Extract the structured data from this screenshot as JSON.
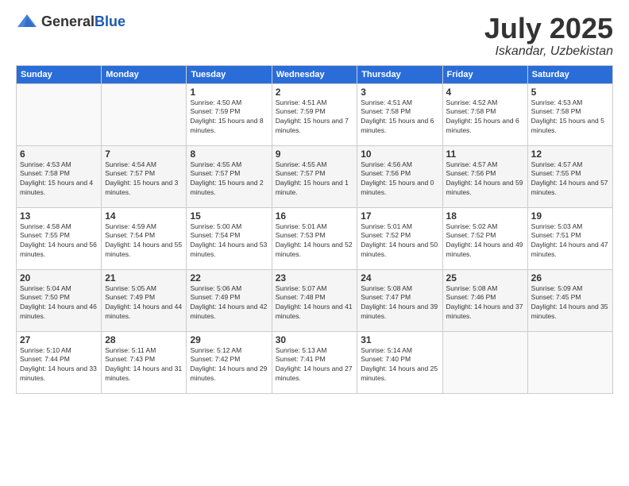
{
  "header": {
    "logo_general": "General",
    "logo_blue": "Blue",
    "month": "July 2025",
    "location": "Iskandar, Uzbekistan"
  },
  "days_of_week": [
    "Sunday",
    "Monday",
    "Tuesday",
    "Wednesday",
    "Thursday",
    "Friday",
    "Saturday"
  ],
  "weeks": [
    [
      {
        "day": "",
        "sunrise": "",
        "sunset": "",
        "daylight": ""
      },
      {
        "day": "",
        "sunrise": "",
        "sunset": "",
        "daylight": ""
      },
      {
        "day": "1",
        "sunrise": "Sunrise: 4:50 AM",
        "sunset": "Sunset: 7:59 PM",
        "daylight": "Daylight: 15 hours and 8 minutes."
      },
      {
        "day": "2",
        "sunrise": "Sunrise: 4:51 AM",
        "sunset": "Sunset: 7:59 PM",
        "daylight": "Daylight: 15 hours and 7 minutes."
      },
      {
        "day": "3",
        "sunrise": "Sunrise: 4:51 AM",
        "sunset": "Sunset: 7:58 PM",
        "daylight": "Daylight: 15 hours and 6 minutes."
      },
      {
        "day": "4",
        "sunrise": "Sunrise: 4:52 AM",
        "sunset": "Sunset: 7:58 PM",
        "daylight": "Daylight: 15 hours and 6 minutes."
      },
      {
        "day": "5",
        "sunrise": "Sunrise: 4:53 AM",
        "sunset": "Sunset: 7:58 PM",
        "daylight": "Daylight: 15 hours and 5 minutes."
      }
    ],
    [
      {
        "day": "6",
        "sunrise": "Sunrise: 4:53 AM",
        "sunset": "Sunset: 7:58 PM",
        "daylight": "Daylight: 15 hours and 4 minutes."
      },
      {
        "day": "7",
        "sunrise": "Sunrise: 4:54 AM",
        "sunset": "Sunset: 7:57 PM",
        "daylight": "Daylight: 15 hours and 3 minutes."
      },
      {
        "day": "8",
        "sunrise": "Sunrise: 4:55 AM",
        "sunset": "Sunset: 7:57 PM",
        "daylight": "Daylight: 15 hours and 2 minutes."
      },
      {
        "day": "9",
        "sunrise": "Sunrise: 4:55 AM",
        "sunset": "Sunset: 7:57 PM",
        "daylight": "Daylight: 15 hours and 1 minute."
      },
      {
        "day": "10",
        "sunrise": "Sunrise: 4:56 AM",
        "sunset": "Sunset: 7:56 PM",
        "daylight": "Daylight: 15 hours and 0 minutes."
      },
      {
        "day": "11",
        "sunrise": "Sunrise: 4:57 AM",
        "sunset": "Sunset: 7:56 PM",
        "daylight": "Daylight: 14 hours and 59 minutes."
      },
      {
        "day": "12",
        "sunrise": "Sunrise: 4:57 AM",
        "sunset": "Sunset: 7:55 PM",
        "daylight": "Daylight: 14 hours and 57 minutes."
      }
    ],
    [
      {
        "day": "13",
        "sunrise": "Sunrise: 4:58 AM",
        "sunset": "Sunset: 7:55 PM",
        "daylight": "Daylight: 14 hours and 56 minutes."
      },
      {
        "day": "14",
        "sunrise": "Sunrise: 4:59 AM",
        "sunset": "Sunset: 7:54 PM",
        "daylight": "Daylight: 14 hours and 55 minutes."
      },
      {
        "day": "15",
        "sunrise": "Sunrise: 5:00 AM",
        "sunset": "Sunset: 7:54 PM",
        "daylight": "Daylight: 14 hours and 53 minutes."
      },
      {
        "day": "16",
        "sunrise": "Sunrise: 5:01 AM",
        "sunset": "Sunset: 7:53 PM",
        "daylight": "Daylight: 14 hours and 52 minutes."
      },
      {
        "day": "17",
        "sunrise": "Sunrise: 5:01 AM",
        "sunset": "Sunset: 7:52 PM",
        "daylight": "Daylight: 14 hours and 50 minutes."
      },
      {
        "day": "18",
        "sunrise": "Sunrise: 5:02 AM",
        "sunset": "Sunset: 7:52 PM",
        "daylight": "Daylight: 14 hours and 49 minutes."
      },
      {
        "day": "19",
        "sunrise": "Sunrise: 5:03 AM",
        "sunset": "Sunset: 7:51 PM",
        "daylight": "Daylight: 14 hours and 47 minutes."
      }
    ],
    [
      {
        "day": "20",
        "sunrise": "Sunrise: 5:04 AM",
        "sunset": "Sunset: 7:50 PM",
        "daylight": "Daylight: 14 hours and 46 minutes."
      },
      {
        "day": "21",
        "sunrise": "Sunrise: 5:05 AM",
        "sunset": "Sunset: 7:49 PM",
        "daylight": "Daylight: 14 hours and 44 minutes."
      },
      {
        "day": "22",
        "sunrise": "Sunrise: 5:06 AM",
        "sunset": "Sunset: 7:49 PM",
        "daylight": "Daylight: 14 hours and 42 minutes."
      },
      {
        "day": "23",
        "sunrise": "Sunrise: 5:07 AM",
        "sunset": "Sunset: 7:48 PM",
        "daylight": "Daylight: 14 hours and 41 minutes."
      },
      {
        "day": "24",
        "sunrise": "Sunrise: 5:08 AM",
        "sunset": "Sunset: 7:47 PM",
        "daylight": "Daylight: 14 hours and 39 minutes."
      },
      {
        "day": "25",
        "sunrise": "Sunrise: 5:08 AM",
        "sunset": "Sunset: 7:46 PM",
        "daylight": "Daylight: 14 hours and 37 minutes."
      },
      {
        "day": "26",
        "sunrise": "Sunrise: 5:09 AM",
        "sunset": "Sunset: 7:45 PM",
        "daylight": "Daylight: 14 hours and 35 minutes."
      }
    ],
    [
      {
        "day": "27",
        "sunrise": "Sunrise: 5:10 AM",
        "sunset": "Sunset: 7:44 PM",
        "daylight": "Daylight: 14 hours and 33 minutes."
      },
      {
        "day": "28",
        "sunrise": "Sunrise: 5:11 AM",
        "sunset": "Sunset: 7:43 PM",
        "daylight": "Daylight: 14 hours and 31 minutes."
      },
      {
        "day": "29",
        "sunrise": "Sunrise: 5:12 AM",
        "sunset": "Sunset: 7:42 PM",
        "daylight": "Daylight: 14 hours and 29 minutes."
      },
      {
        "day": "30",
        "sunrise": "Sunrise: 5:13 AM",
        "sunset": "Sunset: 7:41 PM",
        "daylight": "Daylight: 14 hours and 27 minutes."
      },
      {
        "day": "31",
        "sunrise": "Sunrise: 5:14 AM",
        "sunset": "Sunset: 7:40 PM",
        "daylight": "Daylight: 14 hours and 25 minutes."
      },
      {
        "day": "",
        "sunrise": "",
        "sunset": "",
        "daylight": ""
      },
      {
        "day": "",
        "sunrise": "",
        "sunset": "",
        "daylight": ""
      }
    ]
  ]
}
